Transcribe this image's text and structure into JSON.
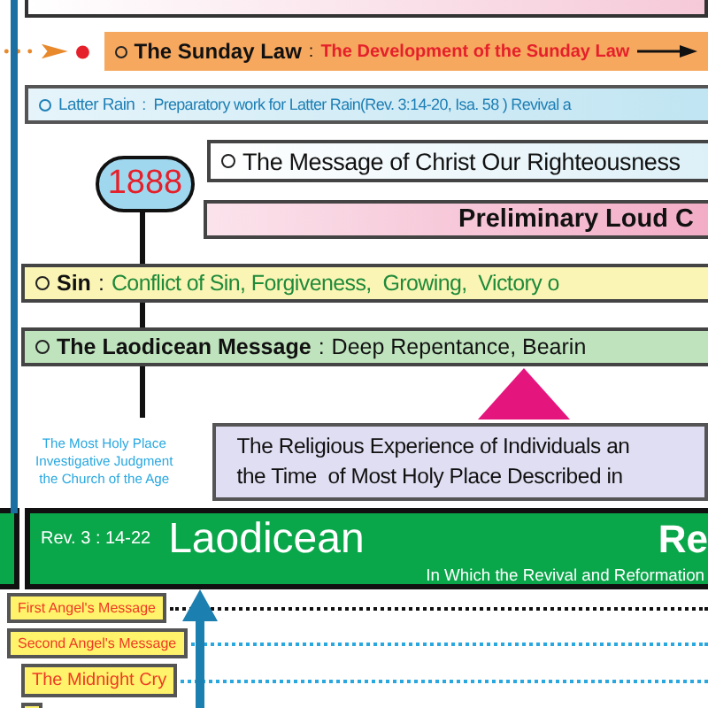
{
  "sunday_law": {
    "label": "The Sunday Law",
    "separator": ":",
    "description": "The Development of the Sunday Law"
  },
  "latter_rain": {
    "label": "Latter Rain",
    "separator": ":",
    "description": "Preparatory work for Latter Rain(Rev. 3:14-20, Isa. 58 ) Revival a"
  },
  "milestone": {
    "year": "1888"
  },
  "christ_message": {
    "text": "The Message of Christ Our Righteousness"
  },
  "loud_cry": {
    "text": "Preliminary Loud C"
  },
  "sin": {
    "label": "Sin",
    "separator": ":",
    "description": "Conflict of Sin, Forgiveness,  Growing,  Victory o"
  },
  "laodicean_message": {
    "label": "The Laodicean Message",
    "separator": ":",
    "description": "Deep Repentance, Bearin"
  },
  "most_holy_place": {
    "lines": [
      "The Most Holy Place",
      "Investigative Judgment",
      "the Church of the Age"
    ]
  },
  "religious_experience": {
    "lines": [
      "The Religious Experience of Individuals an",
      "the Time  of Most Holy Place Described in"
    ]
  },
  "church_band": {
    "reference": "Rev. 3 : 14-22",
    "name": "Laodicean",
    "heading": "Re",
    "subtitle": "In Which the Revival and Reformation"
  },
  "messages": [
    {
      "label": "First Angel's Message",
      "color": "#111111"
    },
    {
      "label": "Second Angel's Message",
      "color": "#29a8e0"
    },
    {
      "label": "The Midnight Cry",
      "color": "#29a8e0"
    }
  ]
}
